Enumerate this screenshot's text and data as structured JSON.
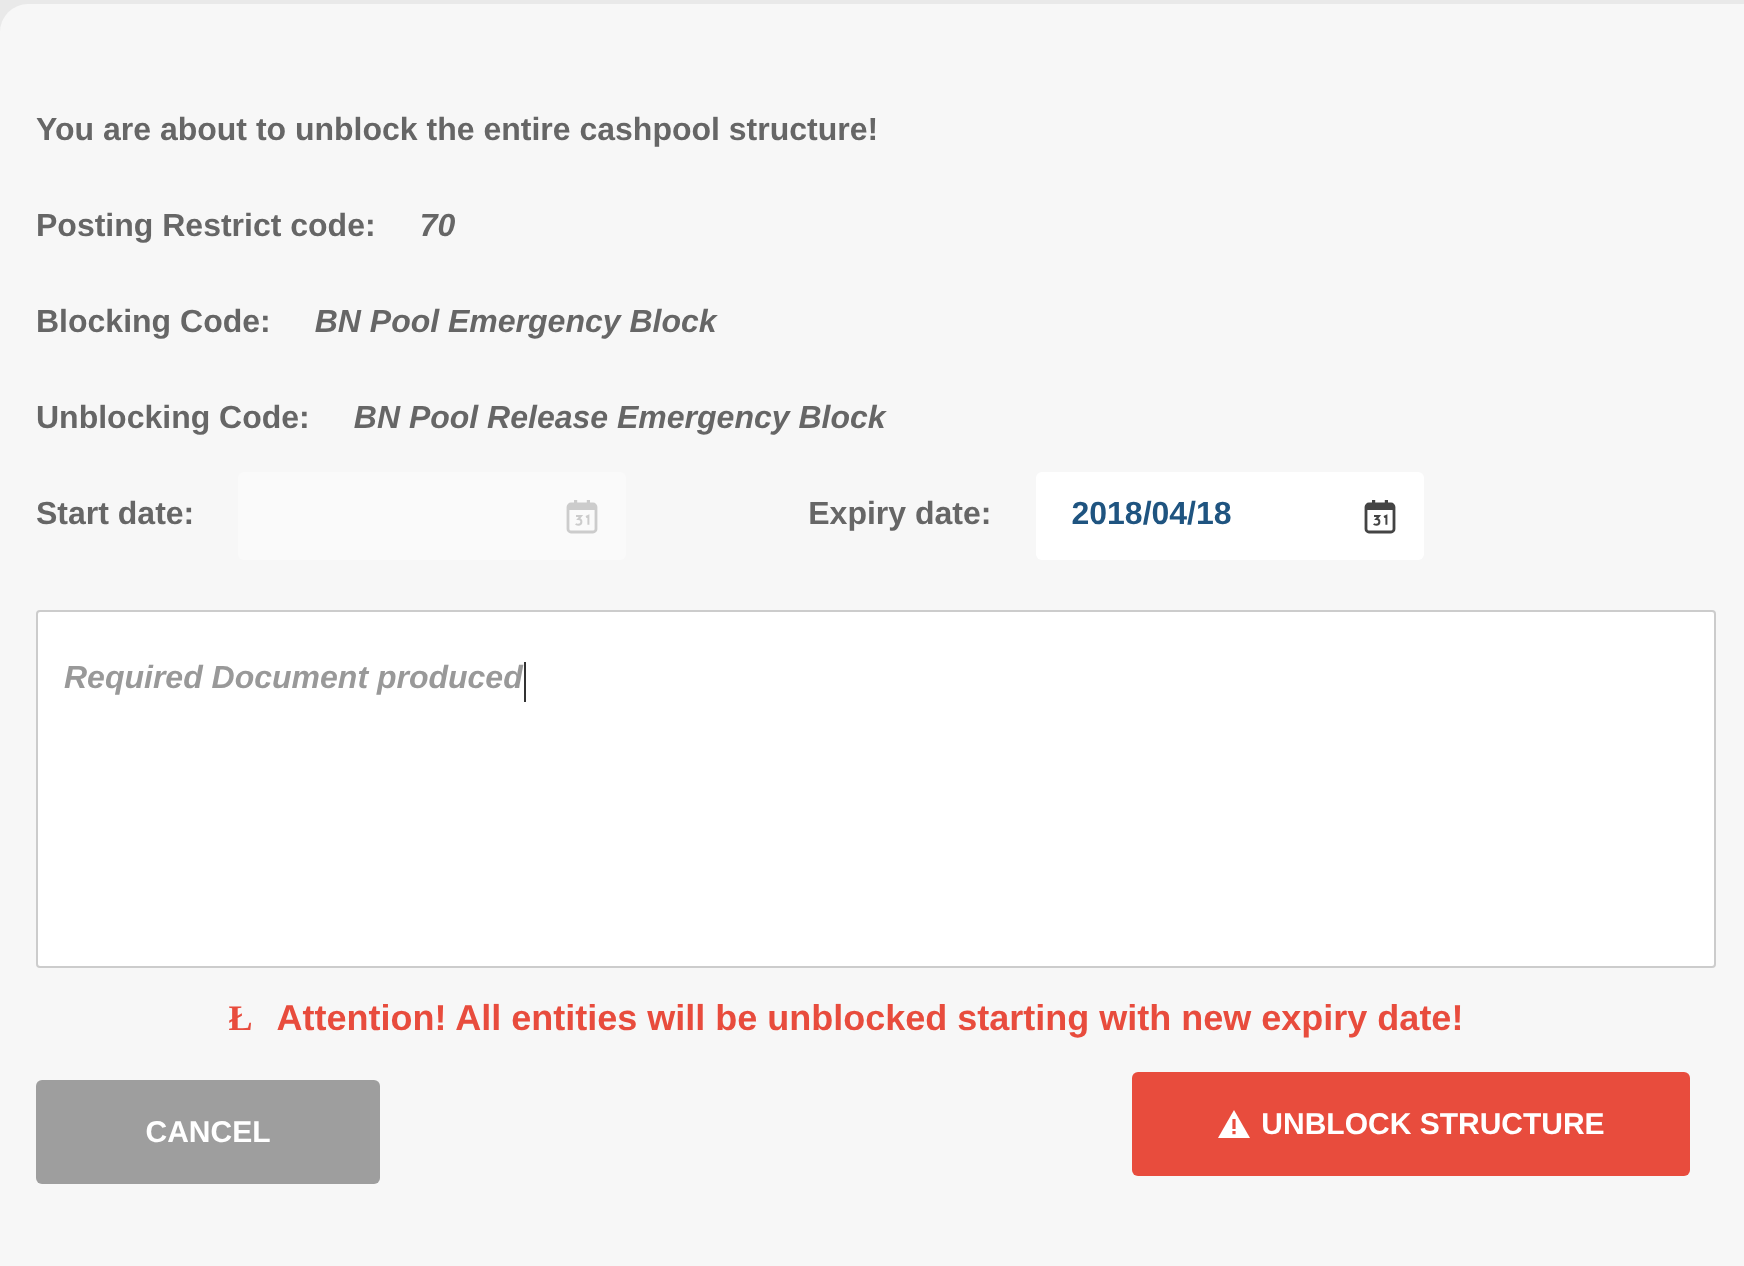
{
  "heading": "You are about to unblock the entire cashpool structure!",
  "details": [
    {
      "label": "Posting Restrict code:",
      "value": "70"
    },
    {
      "label": "Blocking Code:",
      "value": "BN Pool Emergency Block"
    },
    {
      "label": "Unblocking Code:",
      "value": "BN Pool Release Emergency Block"
    }
  ],
  "dates": [
    {
      "label": "Start date:",
      "disabled": true
    },
    {
      "label": "Expiry date:",
      "value": "2018/04/18",
      "disabled": false
    }
  ],
  "comment": {
    "value": "Required Document produced"
  },
  "warning": {
    "icon": "Ł",
    "text": "Attention! All entities will be unblocked starting with new expiry date!"
  },
  "buttons": [
    {
      "kind": "secondary",
      "label": "CANCEL"
    },
    {
      "kind": "danger",
      "label": "UNBLOCK STRUCTURE"
    }
  ]
}
